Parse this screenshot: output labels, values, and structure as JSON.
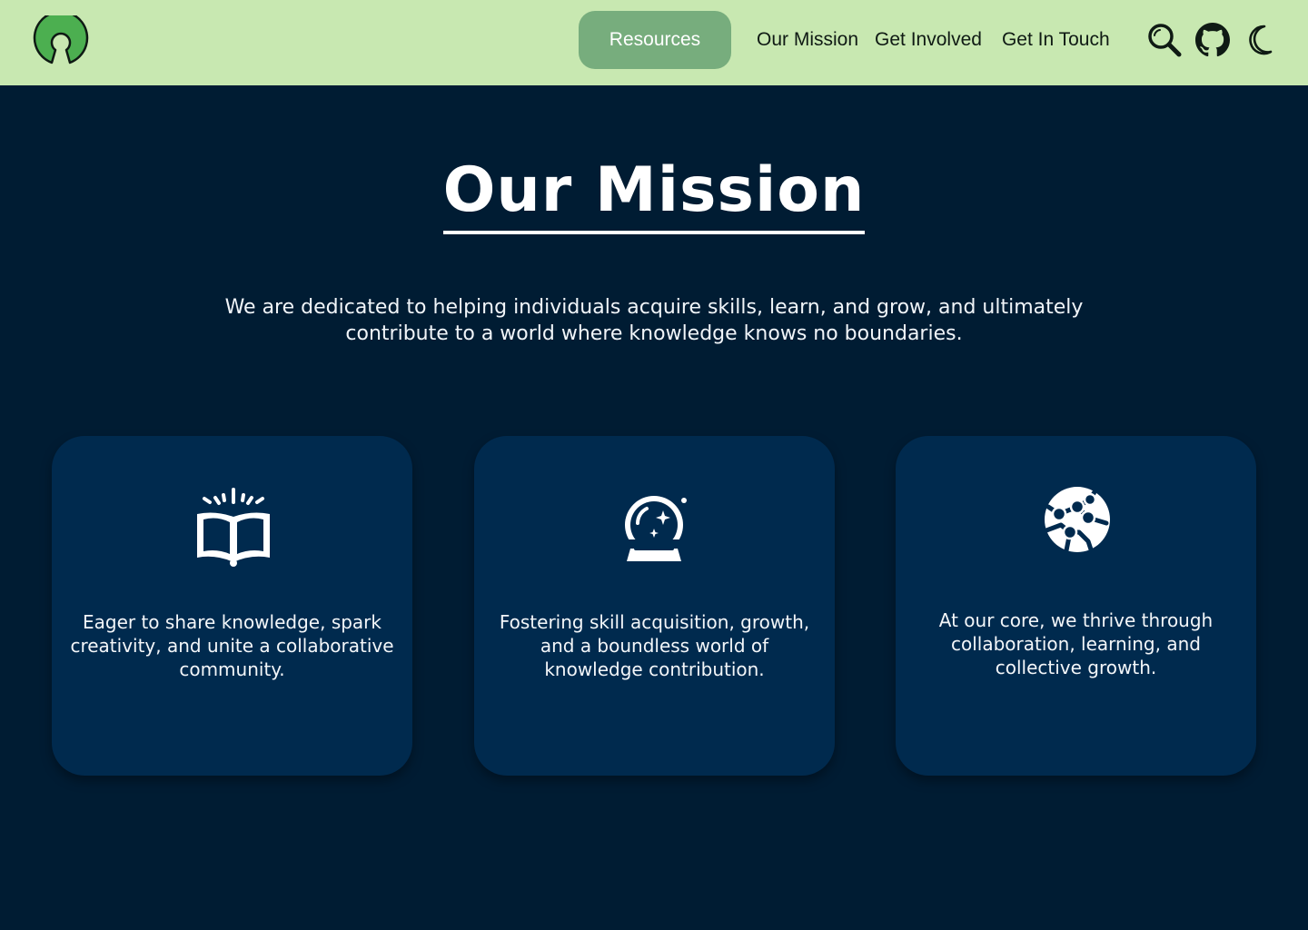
{
  "nav": {
    "logo": "open-source-logo",
    "links": [
      {
        "label": "Resources",
        "active": true
      },
      {
        "label": "Our Mission",
        "active": false
      },
      {
        "label": "Get Involved",
        "active": false
      },
      {
        "label": "Get In Touch",
        "active": false
      }
    ],
    "icons": [
      "search-icon",
      "github-icon",
      "moon-icon"
    ]
  },
  "hero": {
    "title": "Our Mission",
    "intro": "We are dedicated to helping individuals acquire skills, learn, and grow, and ultimately contribute to a world where knowledge knows no boundaries."
  },
  "cards": [
    {
      "icon": "open-book-icon",
      "text": "Eager to share knowledge, spark creativity, and unite a collaborative community."
    },
    {
      "icon": "crystal-ball-icon",
      "text": "Fostering skill acquisition, growth, and a boundless world of knowledge contribution."
    },
    {
      "icon": "network-globe-icon",
      "text": "At our core, we thrive through collaboration, learning, and collective growth."
    }
  ],
  "colors": {
    "nav_bg": "#c8e8b1",
    "active_btn": "#77ad7d",
    "page_bg": "#001c33",
    "card_bg": "#002a4e",
    "logo_green": "#4caf50"
  }
}
